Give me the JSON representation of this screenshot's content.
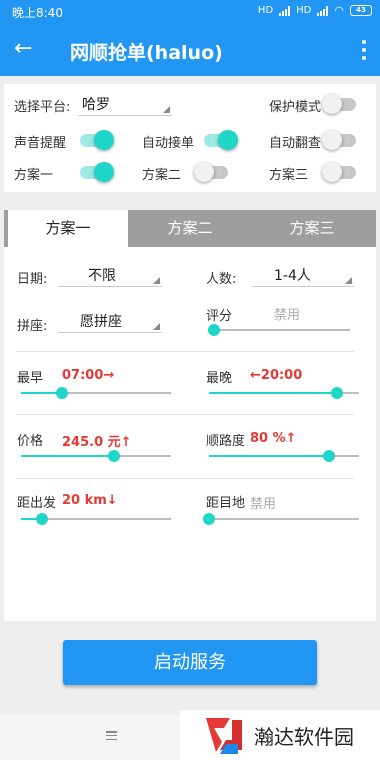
{
  "status": {
    "time": "晚上8:40",
    "net1": "HD",
    "net2": "HD",
    "battery": "43"
  },
  "appbar": {
    "title": "网顺抢单(haluo)"
  },
  "settings": {
    "platform_label": "选择平台:",
    "platform_value": "哈罗",
    "protect_label": "保护模式",
    "protect_on": false,
    "sound_label": "声音提醒",
    "sound_on": true,
    "auto_accept_label": "自动接单",
    "auto_accept_on": true,
    "auto_flip_label": "自动翻查",
    "auto_flip_on": false,
    "plan1_label": "方案一",
    "plan1_on": true,
    "plan2_label": "方案二",
    "plan2_on": false,
    "plan3_label": "方案三",
    "plan3_on": false
  },
  "tabs": [
    "方案一",
    "方案二",
    "方案三"
  ],
  "plan": {
    "date_label": "日期:",
    "date_value": "不限",
    "people_label": "人数:",
    "people_value": "1-4人",
    "carpool_label": "拼座:",
    "carpool_value": "愿拼座",
    "rating_label": "评分",
    "rating_value": "禁用",
    "rating_level": 0,
    "earliest_label": "最早",
    "earliest_value": "07:00→",
    "earliest_level": 0.27,
    "latest_label": "最晚",
    "latest_value": "←20:00",
    "latest_level": 0.85,
    "price_label": "价格",
    "price_value": "245.0 元↑",
    "price_level": 0.62,
    "route_label": "顺路度",
    "route_value": "80 %↑",
    "route_level": 0.8,
    "depart_label": "距出发",
    "depart_value": "20 km↓",
    "depart_level": 0.14,
    "dest_label": "距目地",
    "dest_value": "禁用",
    "dest_level": 0
  },
  "start_button": "启动服务",
  "watermark": {
    "text": "瀚达软件园"
  },
  "colors": {
    "primary": "#2196f3",
    "accent": "#1fd6c8",
    "warning": "#e53935"
  }
}
